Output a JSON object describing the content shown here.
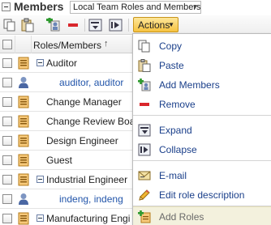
{
  "header": {
    "title": "Members",
    "view_select_value": "Local Team Roles and Members"
  },
  "toolbar": {
    "actions_label": "Actions"
  },
  "table": {
    "column_header": "Roles/Members",
    "sort_indicator": "↑",
    "rows": [
      {
        "label": "Auditor",
        "type": "role",
        "expanded": true
      },
      {
        "label": "auditor, auditor",
        "type": "member"
      },
      {
        "label": "Change Manager",
        "type": "role"
      },
      {
        "label": "Change Review Boar",
        "type": "role"
      },
      {
        "label": "Design Engineer",
        "type": "role"
      },
      {
        "label": "Guest",
        "type": "role"
      },
      {
        "label": "Industrial Engineer",
        "type": "role",
        "expanded": true
      },
      {
        "label": "indeng, indeng",
        "type": "member"
      },
      {
        "label": "Manufacturing Engi",
        "type": "role",
        "expanded": true
      }
    ]
  },
  "menu": {
    "items": [
      {
        "label": "Copy",
        "icon": "copy-icon"
      },
      {
        "label": "Paste",
        "icon": "paste-icon"
      },
      {
        "label": "Add Members",
        "icon": "add-members-icon"
      },
      {
        "label": "Remove",
        "icon": "remove-icon"
      },
      {
        "label": "Expand",
        "icon": "expand-icon"
      },
      {
        "label": "Collapse",
        "icon": "collapse-icon"
      },
      {
        "label": "E-mail",
        "icon": "email-icon"
      },
      {
        "label": "Edit role description",
        "icon": "pencil-icon"
      },
      {
        "label": "Add Roles",
        "icon": "add-roles-icon"
      }
    ]
  },
  "colors": {
    "actions_button": "#f6c341",
    "menu_label": "#1a3f8a",
    "member_link": "#2255aa",
    "remove_red": "#d9262b",
    "hover_row": "#f3f1dd"
  }
}
